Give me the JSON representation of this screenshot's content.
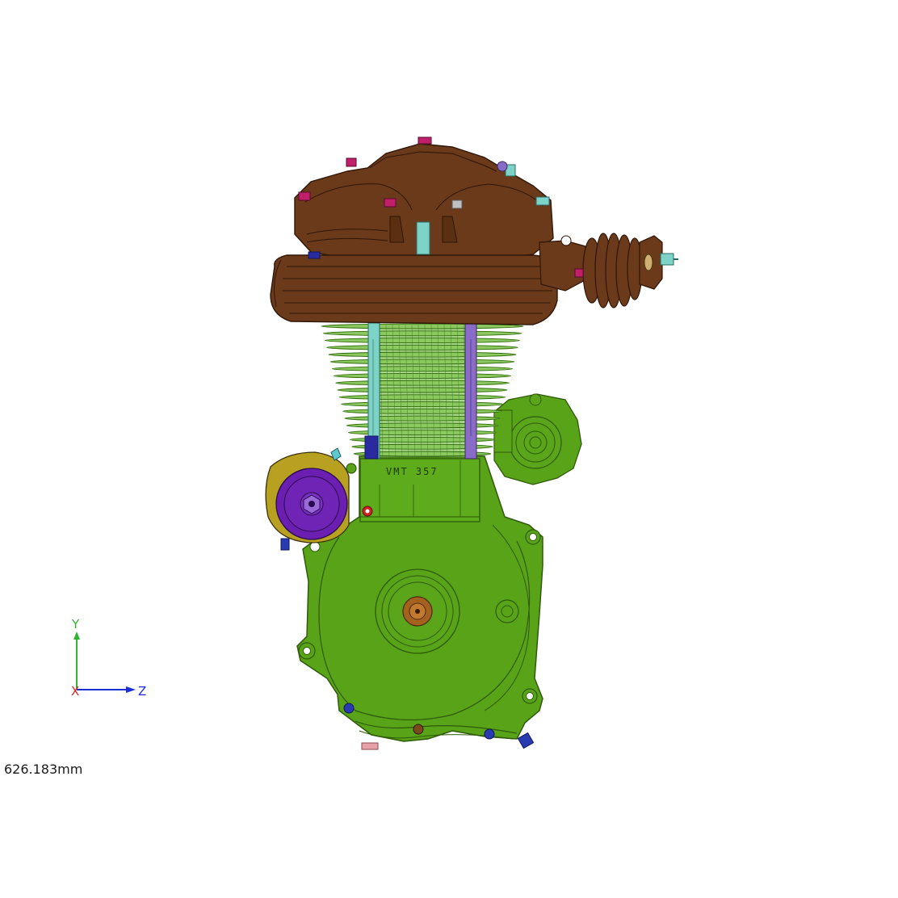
{
  "viewport": {
    "background": "#ffffff",
    "model_name": "motorcycle-single-cylinder-engine"
  },
  "part_engraving": "VMT 357",
  "triad": {
    "y_label": "Y",
    "x_label": "X",
    "z_label": "Z",
    "colors": {
      "y": "#2fb52f",
      "x": "#e02020",
      "z": "#1a2fd6"
    }
  },
  "scale_readout": "626.183mm",
  "colors": {
    "crankcase": "#58a318",
    "crankcase_edge": "#2f5a0a",
    "head": "#6b3a1a",
    "head_edge": "#2e1608",
    "fins": "#5aa02a",
    "magneto": "#6a1fb0",
    "pushrod_left": "#7ed3c8",
    "pushrod_right": "#8a6bc8"
  }
}
